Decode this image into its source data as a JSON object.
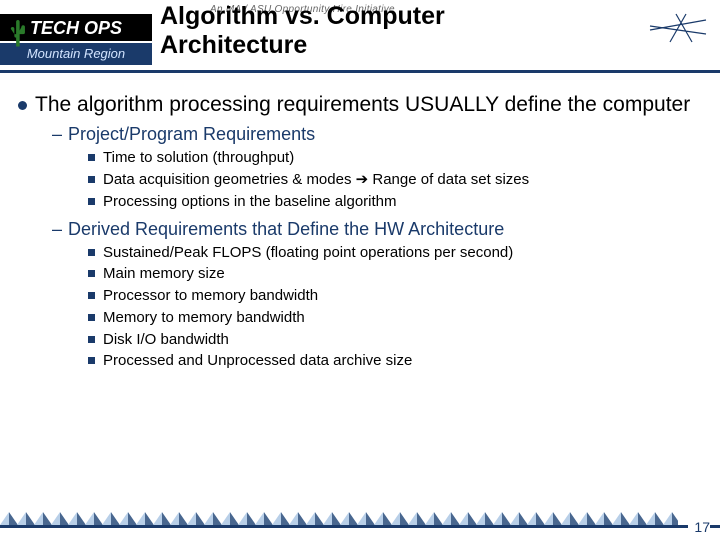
{
  "header": {
    "logo_top": "TECH OPS",
    "logo_bottom": "Mountain Region",
    "watermark": "An MA / ASU Opportunity Hire Initiative",
    "title_line1": "Algorithm vs. Computer",
    "title_line2": "Architecture"
  },
  "main": {
    "bullet": "The algorithm processing requirements USUALLY define the computer",
    "sub1a": "Project/Program Requirements",
    "sub1a_items": [
      "Time to solution (throughput)",
      "Data acquisition geometries & modes ➔ Range of data set sizes",
      "Processing options in the baseline algorithm"
    ],
    "sub1b": "Derived Requirements that Define the HW Architecture",
    "sub1b_items": [
      "Sustained/Peak FLOPS (floating point operations per second)",
      "Main memory size",
      "Processor to memory bandwidth",
      "Memory to memory bandwidth",
      "Disk I/O bandwidth",
      "Processed and Unprocessed data archive size"
    ]
  },
  "footer": {
    "page": "17"
  }
}
